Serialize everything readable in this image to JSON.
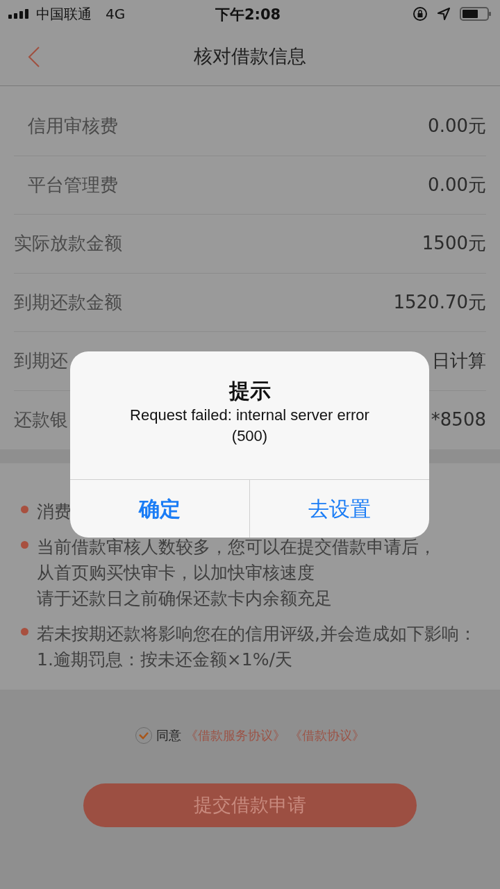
{
  "status_bar": {
    "carrier": "中国联通",
    "network": "4G",
    "time": "下午2:08"
  },
  "nav": {
    "title": "核对借款信息"
  },
  "rows": [
    {
      "kind": "sub",
      "label": "信用审核费",
      "value": "0.00元"
    },
    {
      "kind": "sub",
      "label": "平台管理费",
      "value": "0.00元"
    },
    {
      "kind": "main",
      "label": "实际放款金额",
      "value": "1500元"
    },
    {
      "kind": "main",
      "label": "到期还款金额",
      "value": "1520.70元"
    },
    {
      "kind": "main",
      "label": "到期还",
      "value": "日计算"
    },
    {
      "kind": "main",
      "label": "还款银",
      "value": "*8508"
    }
  ],
  "notes": [
    {
      "lines": [
        "消费"
      ]
    },
    {
      "lines": [
        "当前借款审核人数较多，您可以在提交借款申请后，",
        "从首页购买快审卡，以加快审核速度",
        "请于还款日之前确保还款卡内余额充足"
      ]
    },
    {
      "lines": [
        "若未按期还款将影响您在的信用评级,并会造成如下影响：",
        "1.逾期罚息：按未还金额×1%/天"
      ]
    }
  ],
  "agreement": {
    "checked": true,
    "label": "同意",
    "links": [
      "《借款服务协议》",
      "《借款协议》"
    ]
  },
  "submit_button": {
    "label": "提交借款申请"
  },
  "dialog": {
    "title": "提示",
    "message": "Request failed: internal server error (500)",
    "buttons": [
      "确定",
      "去设置"
    ]
  }
}
